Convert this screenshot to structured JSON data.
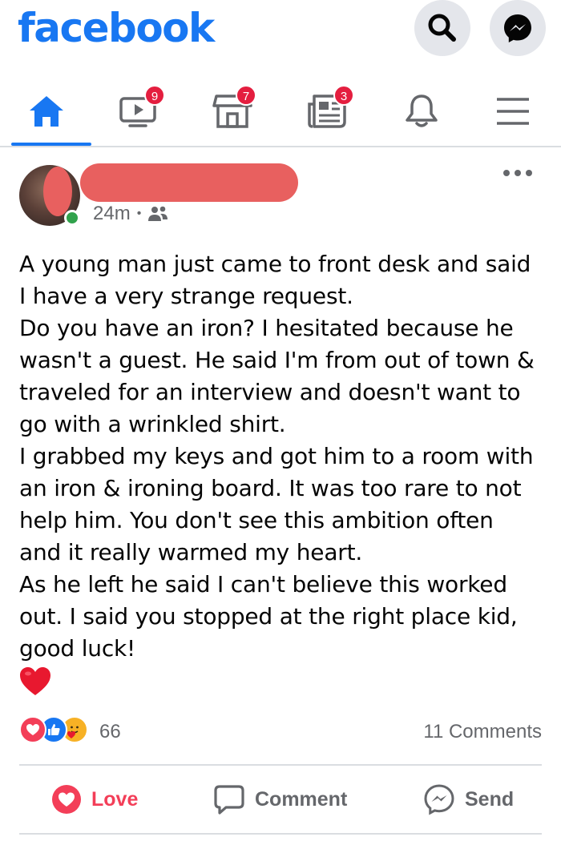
{
  "header": {
    "logo": "facebook"
  },
  "nav": {
    "items": [
      {
        "name": "home",
        "badge": null,
        "active": true
      },
      {
        "name": "watch",
        "badge": "9"
      },
      {
        "name": "marketplace",
        "badge": "7"
      },
      {
        "name": "news",
        "badge": "3"
      },
      {
        "name": "notifications",
        "badge": null
      },
      {
        "name": "menu",
        "badge": null
      }
    ]
  },
  "post": {
    "time": "24m",
    "audience_icon": "friends-icon",
    "lines": [
      "A young man just came to front desk and said",
      "I have a very strange request.",
      "Do you have an iron? I hesitated because he",
      "wasn't a guest. He said I'm from out of town &",
      "traveled for an interview and doesn't want to",
      "go with a wrinkled shirt.",
      "I grabbed my keys and got him to a room with",
      "an iron & ironing board. It was too rare to not",
      "help him. You don't see this ambition often",
      "and it really warmed my heart.",
      "As he left he said I can't believe this worked",
      "out. I said you stopped at the right place kid,",
      "good luck!"
    ],
    "emoji": "heart"
  },
  "reactions": {
    "icons": [
      "love",
      "like",
      "care"
    ],
    "count": "66",
    "comments": "11 Comments"
  },
  "actions": {
    "love": "Love",
    "comment": "Comment",
    "send": "Send"
  },
  "colors": {
    "brand": "#1877f2",
    "love": "#f33e58",
    "badge": "#e41e3f",
    "online": "#31a24c",
    "redaction": "#e8605f",
    "secondary_text": "#65676b"
  }
}
